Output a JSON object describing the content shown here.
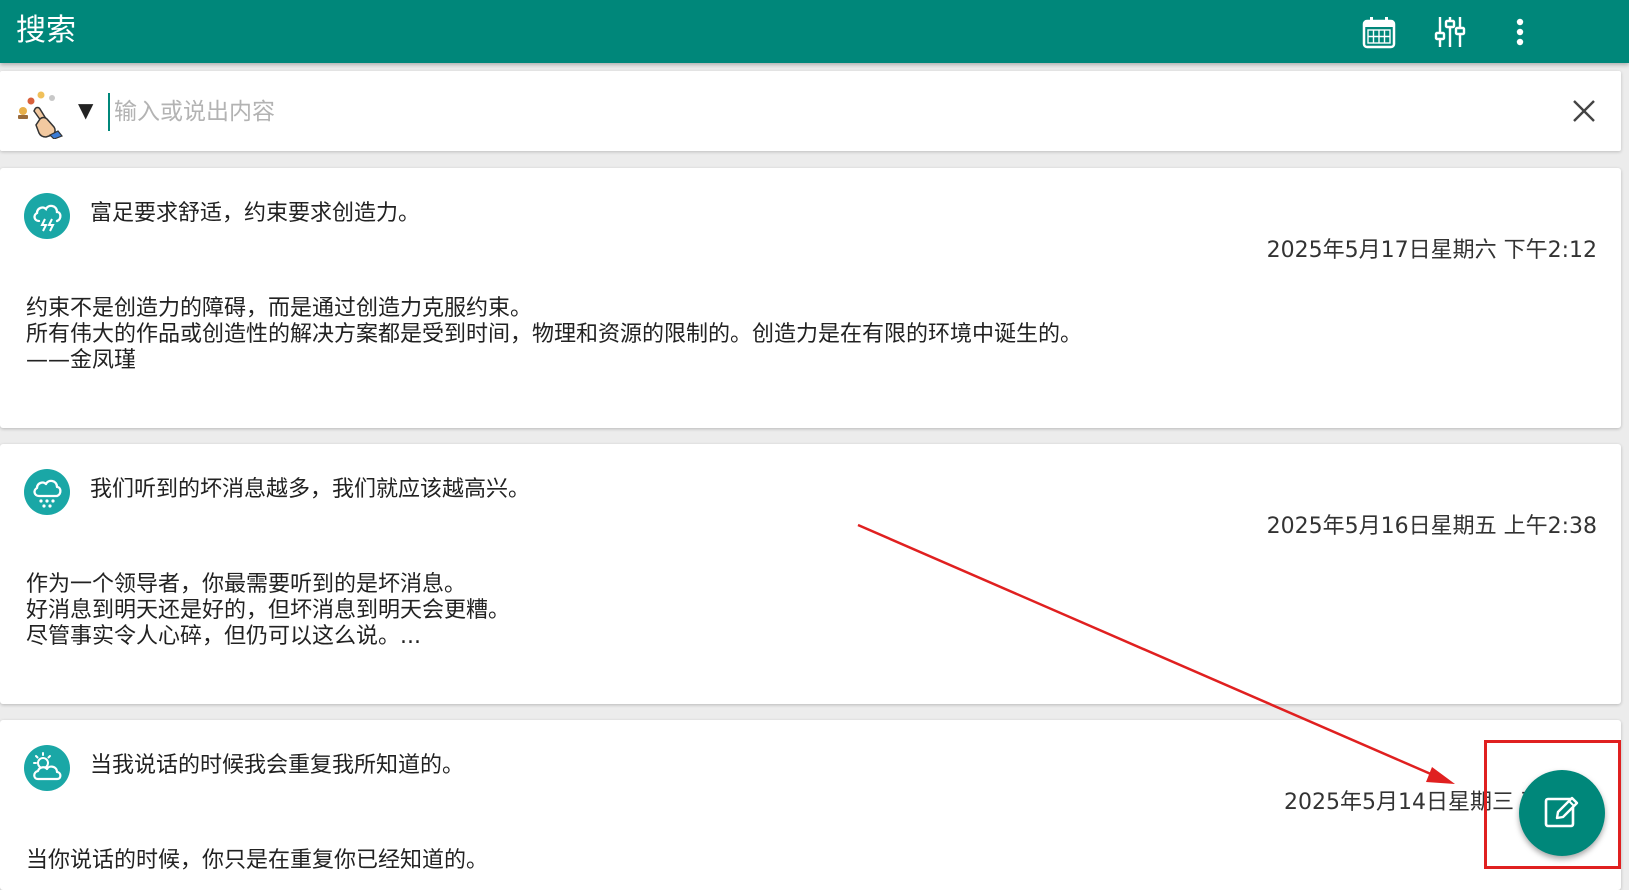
{
  "appbar": {
    "title": "搜索",
    "background": "#00877a",
    "actions": [
      {
        "icon": "calendar-icon"
      },
      {
        "icon": "filter-sliders-icon"
      },
      {
        "icon": "more-vert-icon"
      }
    ]
  },
  "search": {
    "placeholder": "输入或说出内容",
    "value": "",
    "source_icon": "hand-pointer-icon",
    "dropdown_symbol": "▼",
    "clear_icon": "close-icon"
  },
  "entries": [
    {
      "icon": "cloud-lightning-icon",
      "title": "富足要求舒适，约束要求创造力。",
      "date": "2025年5月17日星期六 下午2:12",
      "body": [
        "约束不是创造力的障碍，而是通过创造力克服约束。",
        "所有伟大的作品或创造性的解决方案都是受到时间，物理和资源的限制的。创造力是在有限的环境中诞生的。",
        "——金凤瑾"
      ]
    },
    {
      "icon": "cloud-rain-icon",
      "title": "我们听到的坏消息越多，我们就应该越高兴。",
      "date": "2025年5月16日星期五 上午2:38",
      "body": [
        "作为一个领导者，你最需要听到的是坏消息。",
        "好消息到明天还是好的，但坏消息到明天会更糟。",
        "尽管事实令人心碎，但仍可以这么说。..."
      ]
    },
    {
      "icon": "sun-cloud-icon",
      "title": "当我说话的时候我会重复我所知道的。",
      "date": "2025年5月14日星期三 下",
      "body": [
        "当你说话的时候，你只是在重复你已经知道的。"
      ]
    }
  ],
  "fab": {
    "icon": "edit-icon",
    "color": "#00877a"
  },
  "annotation": {
    "color": "#e02020"
  }
}
